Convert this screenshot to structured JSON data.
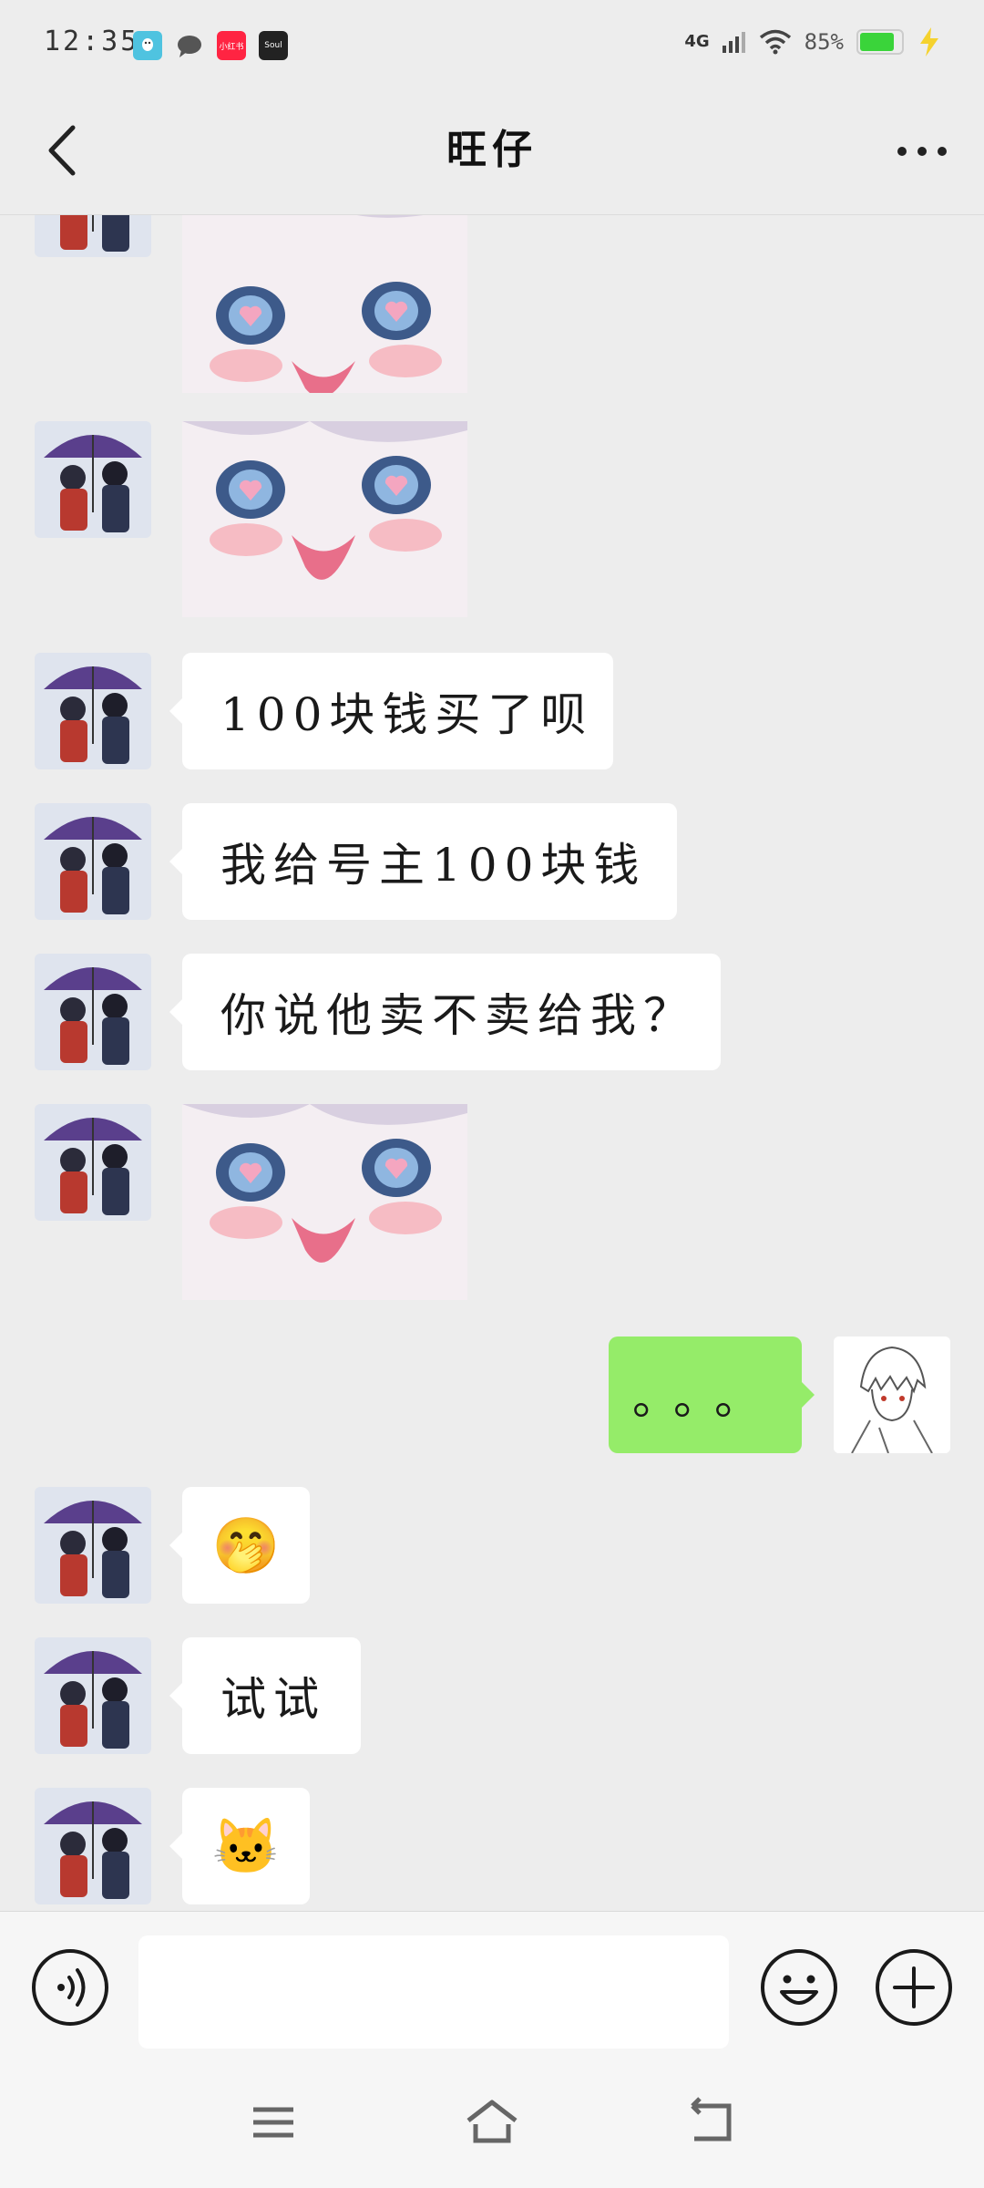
{
  "status_bar": {
    "time": "12:35",
    "apps": [
      {
        "icon": "qq-icon",
        "label": "",
        "color": "#4fc3e0"
      },
      {
        "icon": "message-icon",
        "label": "",
        "color": "#555555"
      },
      {
        "icon": "xiaohongshu-icon",
        "label": "小红书",
        "color": "#ff2442"
      },
      {
        "icon": "soul-icon",
        "label": "Soul",
        "color": "#222222"
      }
    ],
    "network": "4G",
    "battery_percent": "85%",
    "battery_level": 0.85,
    "battery_color": "#3ad43a"
  },
  "nav": {
    "title": "旺仔"
  },
  "messages": [
    {
      "side": "left",
      "type": "sticker",
      "sticker": "anime-girl-tongue-sticker"
    },
    {
      "side": "left",
      "type": "sticker",
      "sticker": "anime-girl-tongue-sticker"
    },
    {
      "side": "left",
      "type": "text",
      "text": "100块钱买了呗"
    },
    {
      "side": "left",
      "type": "text",
      "text": "我给号主100块钱"
    },
    {
      "side": "left",
      "type": "text",
      "text": "你说他卖不卖给我？"
    },
    {
      "side": "left",
      "type": "sticker",
      "sticker": "anime-girl-tongue-sticker"
    },
    {
      "side": "right",
      "type": "text",
      "text": "。。。"
    },
    {
      "side": "left",
      "type": "emoji",
      "text": "🤭"
    },
    {
      "side": "left",
      "type": "text",
      "text": "试试"
    },
    {
      "side": "left",
      "type": "emoji",
      "text": "🐱"
    }
  ],
  "colors": {
    "background": "#ededed",
    "bubble_left": "#ffffff",
    "bubble_right": "#95ec69"
  },
  "input_bar": {
    "voice_icon": "voice-icon",
    "emoji_icon": "smiley-icon",
    "plus_icon": "plus-icon",
    "value": ""
  },
  "system_nav": {
    "icons": [
      "menu-icon",
      "home-icon",
      "back-icon"
    ]
  }
}
